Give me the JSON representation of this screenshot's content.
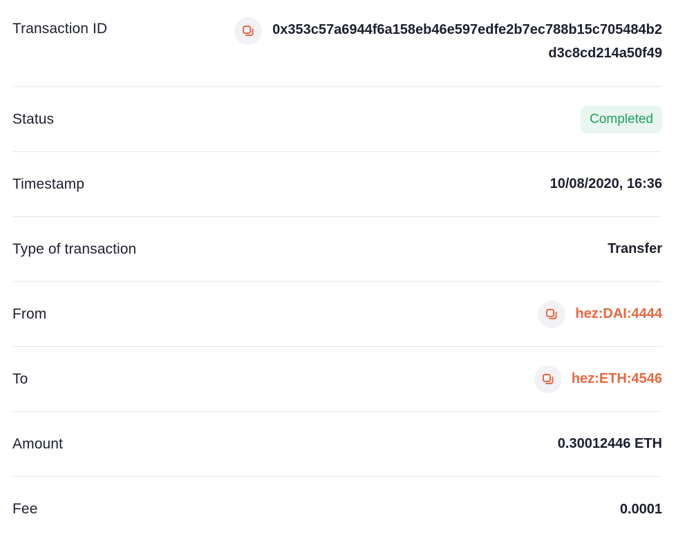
{
  "accent_color": "#e9673f",
  "status_color": "#1f9d5c",
  "rows": {
    "transaction_id": {
      "label": "Transaction ID",
      "value": "0x353c57a6944f6a158eb46e597edfe2b7ec788b15c705484b2d3c8cd214a50f49",
      "icon": "copy-icon"
    },
    "status": {
      "label": "Status",
      "value": "Completed"
    },
    "timestamp": {
      "label": "Timestamp",
      "value": "10/08/2020, 16:36"
    },
    "type": {
      "label": "Type of transaction",
      "value": "Transfer"
    },
    "from": {
      "label": "From",
      "value": "hez:DAI:4444",
      "icon": "copy-icon"
    },
    "to": {
      "label": "To",
      "value": "hez:ETH:4546",
      "icon": "copy-icon"
    },
    "amount": {
      "label": "Amount",
      "value": "0.30012446 ETH"
    },
    "fee": {
      "label": "Fee",
      "value": "0.0001"
    }
  }
}
